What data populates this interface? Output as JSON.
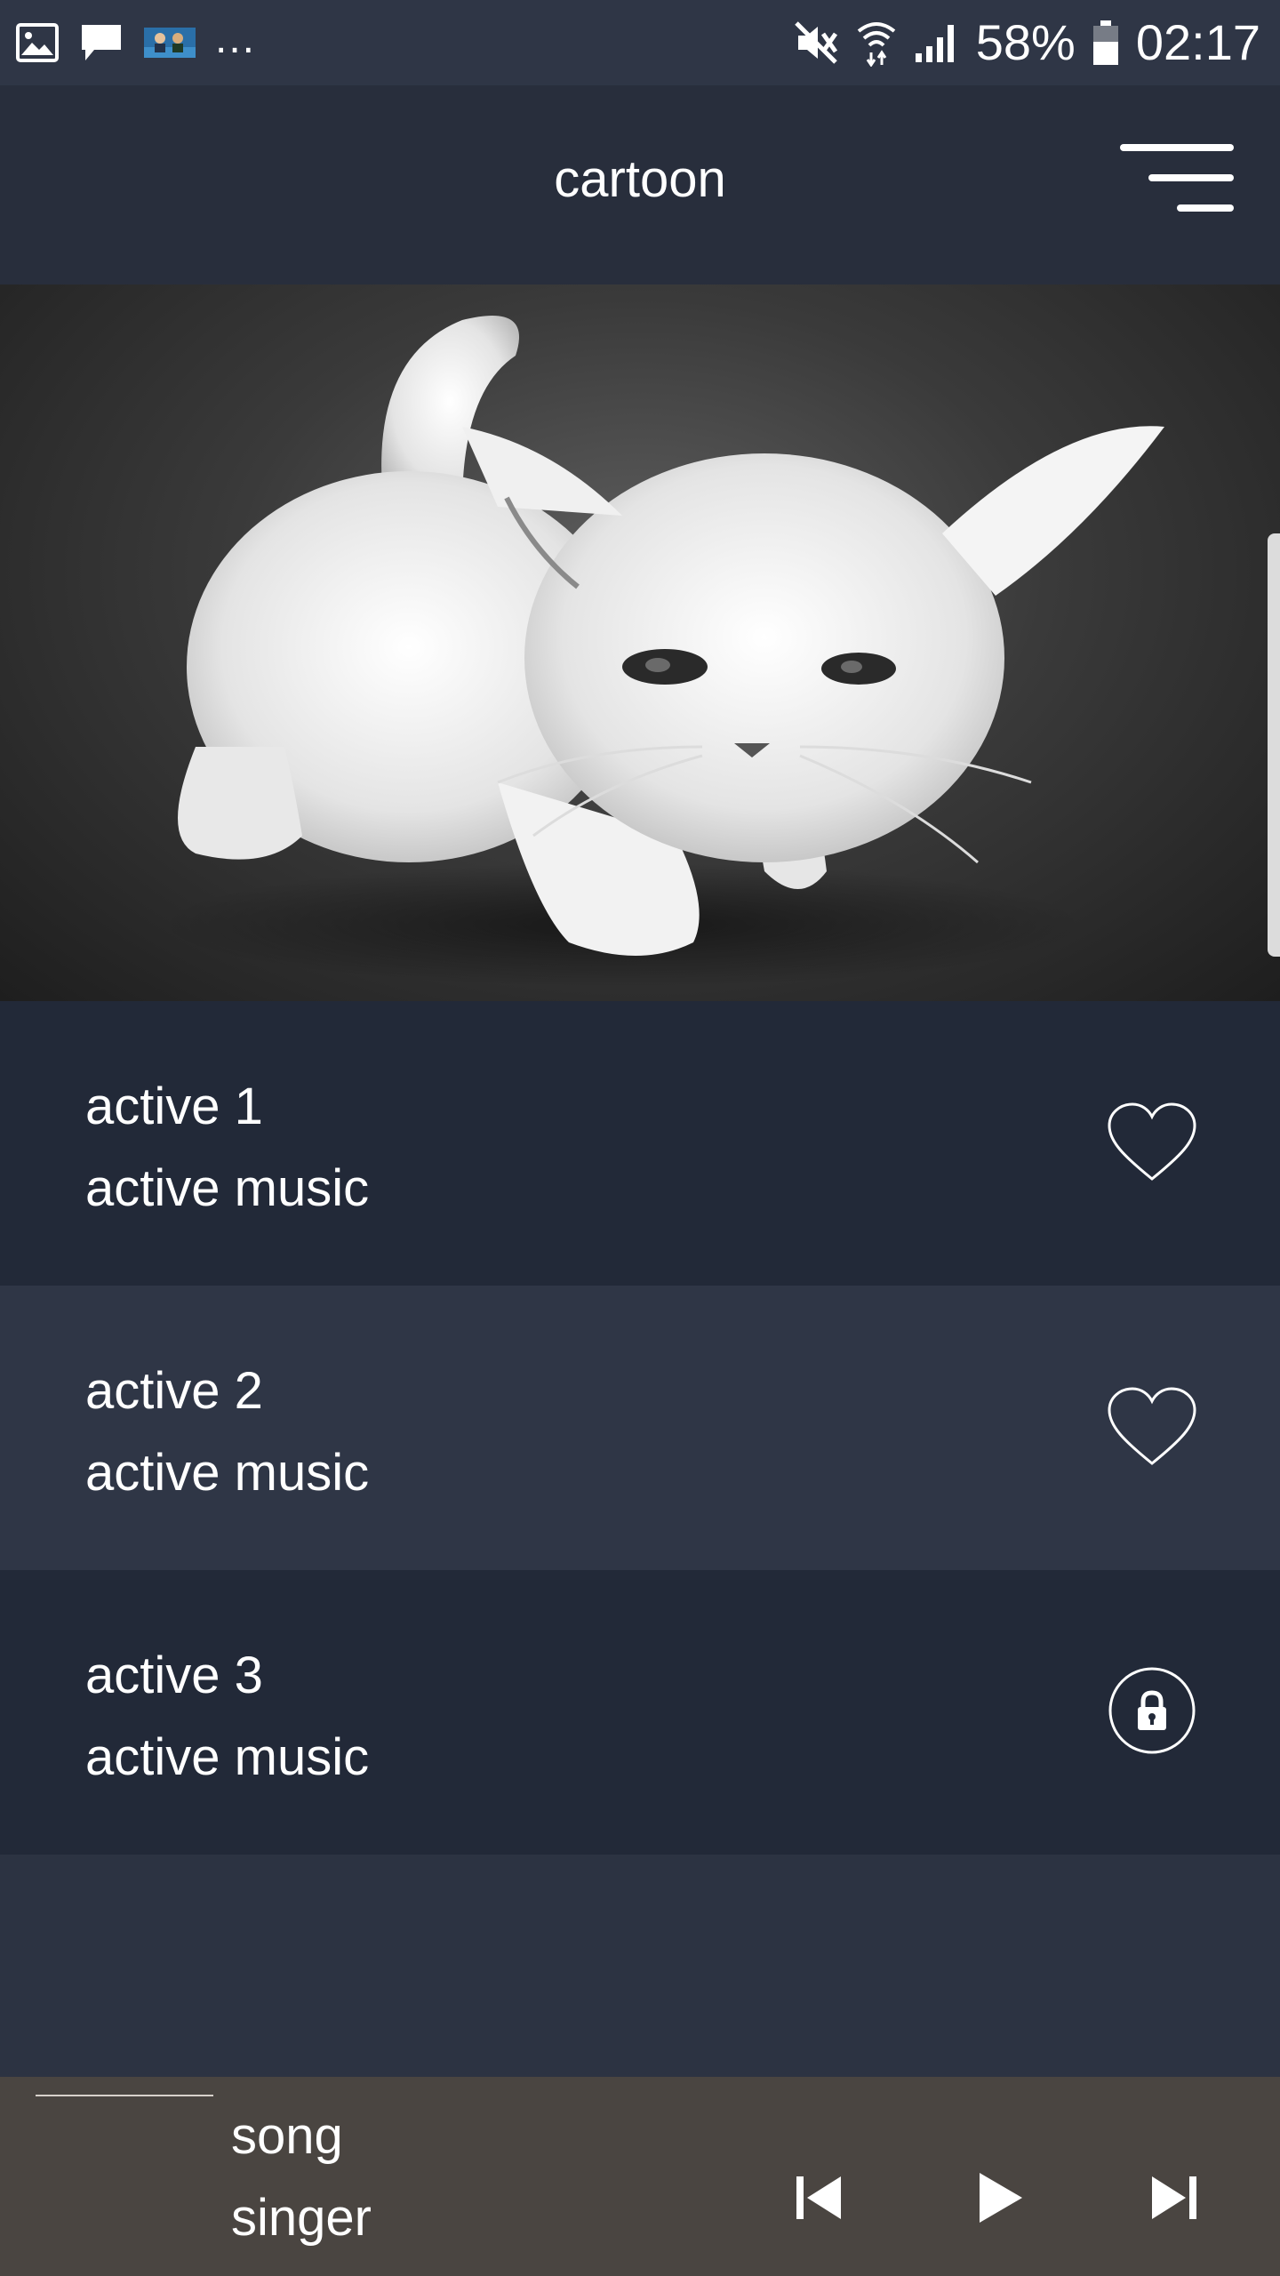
{
  "status_bar": {
    "battery": "58%",
    "time": "02:17",
    "more": "..."
  },
  "toolbar": {
    "title": "cartoon"
  },
  "tracks": [
    {
      "title": "active 1",
      "subtitle": "active music",
      "icon": "heart-outline-icon"
    },
    {
      "title": "active 2",
      "subtitle": "active music",
      "icon": "heart-outline-icon"
    },
    {
      "title": "active 3",
      "subtitle": "active music",
      "icon": "lock-icon"
    }
  ],
  "player": {
    "song": "song",
    "singer": "singer"
  },
  "colors": {
    "status_bar": "#2f3646",
    "toolbar": "#282e3c",
    "row_dark": "#222938",
    "row_light": "#2f3646",
    "player_bar": "#4a4541"
  }
}
